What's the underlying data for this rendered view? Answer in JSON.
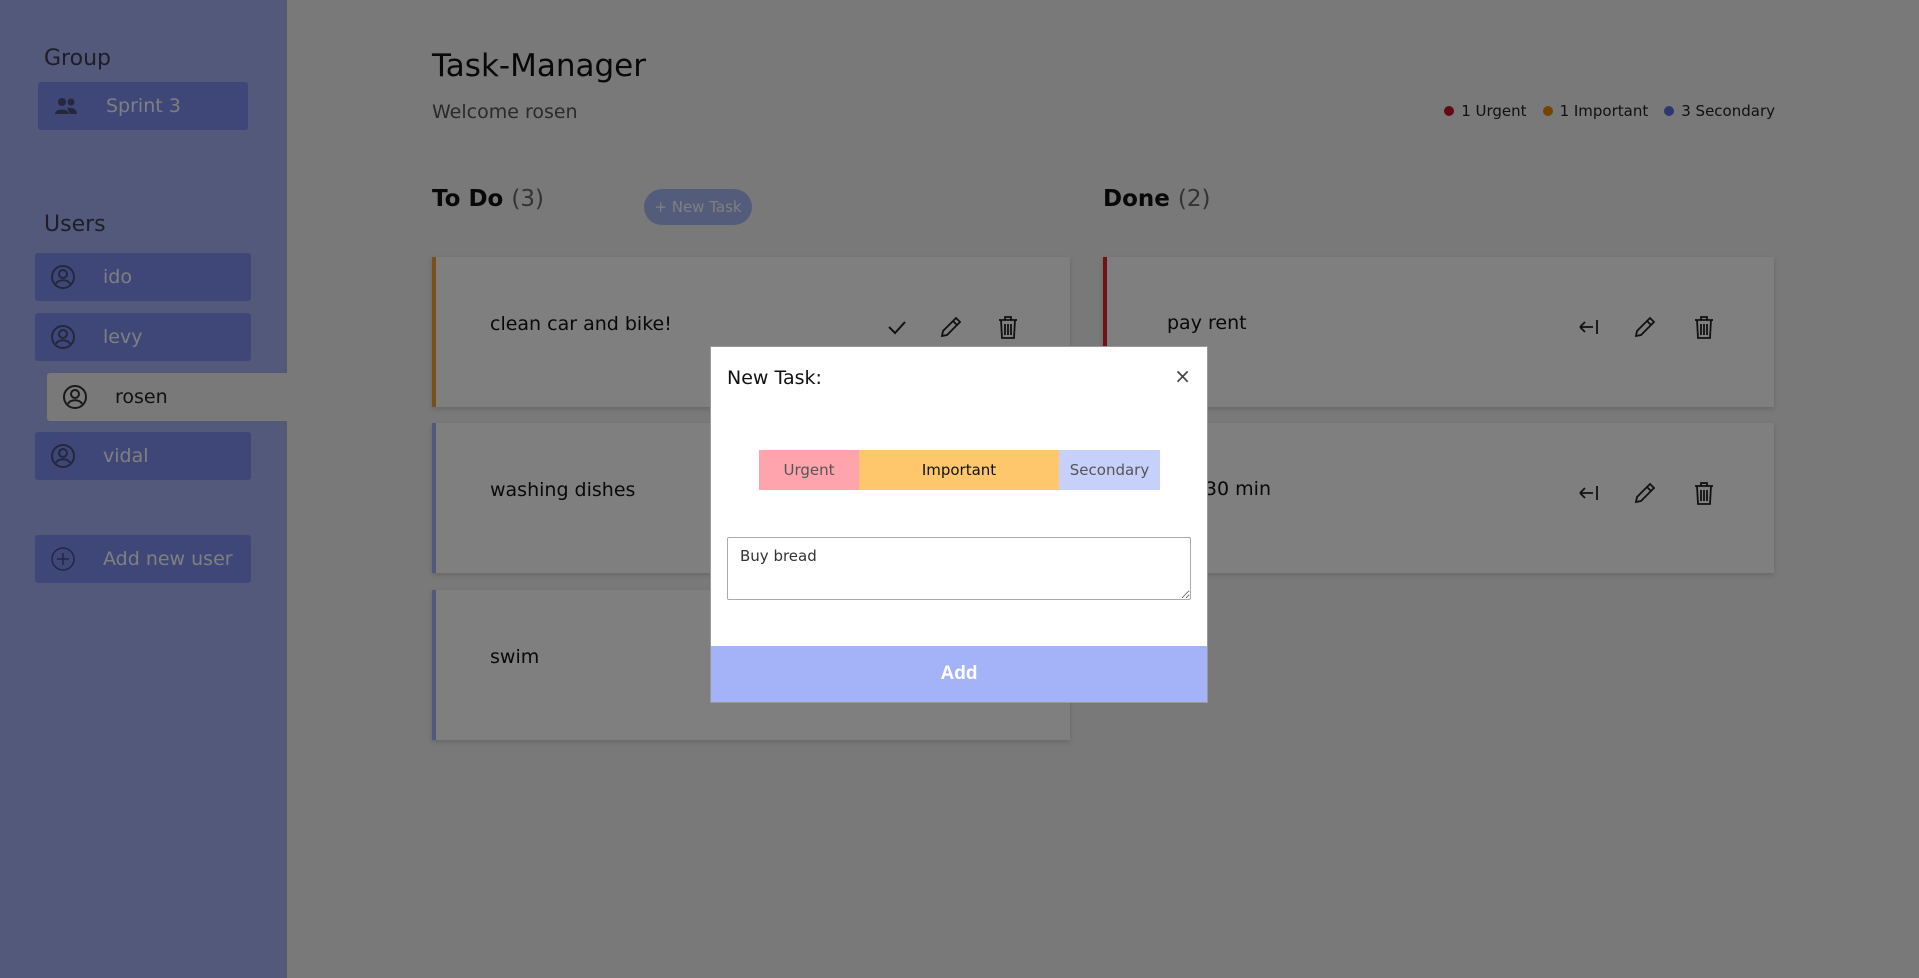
{
  "sidebar": {
    "group_heading": "Group",
    "group_name": "Sprint 3",
    "users_heading": "Users",
    "users": [
      {
        "name": "ido"
      },
      {
        "name": "levy"
      },
      {
        "name": "rosen"
      },
      {
        "name": "vidal"
      }
    ],
    "selected_user": "rosen",
    "add_user_label": "Add new user"
  },
  "header": {
    "title": "Task-Manager",
    "welcome": "Welcome rosen"
  },
  "legend": [
    {
      "label": "1 Urgent",
      "color": "#c8102e"
    },
    {
      "label": "1 Important",
      "color": "#e68a00"
    },
    {
      "label": "3 Secondary",
      "color": "#5c6fe0"
    }
  ],
  "todo": {
    "title": "To Do",
    "count": "(3)",
    "new_task_label": "+ New Task",
    "tasks": [
      {
        "text": "clean car and bike!",
        "priority_color": "#f0a030"
      },
      {
        "text": "washing dishes",
        "priority_color": "#a4b3f7"
      },
      {
        "text": "swim",
        "priority_color": "#a4b3f7"
      }
    ]
  },
  "done": {
    "title": "Done",
    "count": "(2)",
    "tasks": [
      {
        "text": "pay rent",
        "priority_color": "#e0202e"
      },
      {
        "text": "run 30 min",
        "priority_color": "#a4b3f7"
      }
    ]
  },
  "modal": {
    "title": "New Task:",
    "close": "×",
    "priorities": [
      "Urgent",
      "Important",
      "Secondary"
    ],
    "selected_priority": "Important",
    "input_value": "Buy bread",
    "add_label": "Add"
  },
  "colors": {
    "sidebar": "#a4b3f7",
    "button": "#7d8ff0",
    "urgent": "#ffa4ad",
    "important": "#ffc76c",
    "secondary": "#c7d0fb"
  }
}
